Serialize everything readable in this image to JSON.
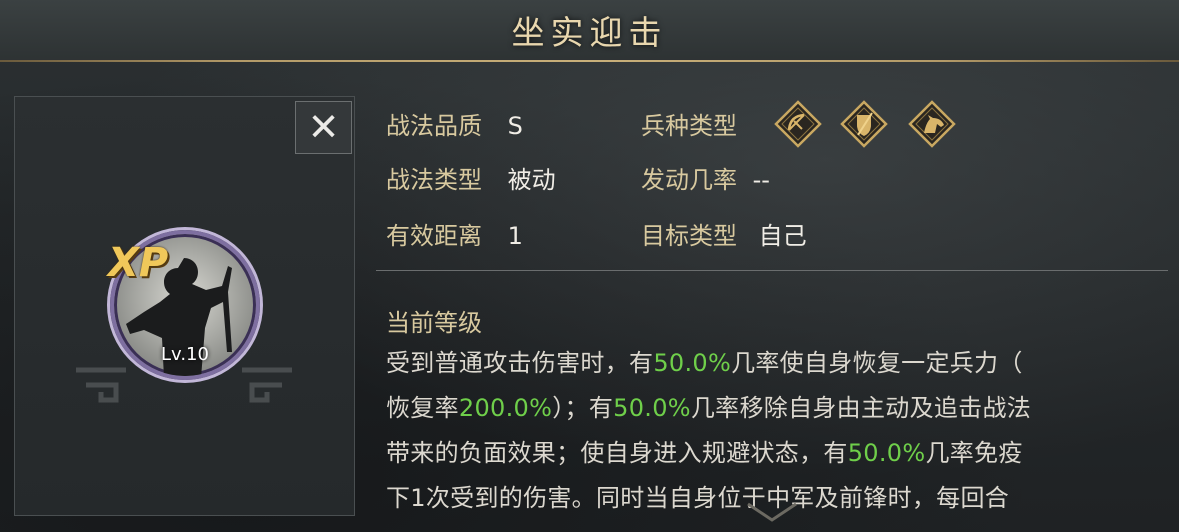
{
  "header": {
    "title": "坐实迎击"
  },
  "close": {
    "label": "✕"
  },
  "skill": {
    "badge": "XP",
    "level": "Lv.10"
  },
  "info": {
    "quality_label": "战法品质",
    "quality_value": "S",
    "type_label": "战法类型",
    "type_value": "被动",
    "range_label": "有效距离",
    "range_value": "1",
    "troop_label": "兵种类型",
    "troop_icons": [
      "bow-icon",
      "shield-icon",
      "horse-icon"
    ],
    "rate_label": "发动几率",
    "rate_value": "--",
    "target_label": "目标类型",
    "target_value": "自己"
  },
  "current_level": {
    "title": "当前等级",
    "lines": [
      [
        {
          "t": "受到普通攻击伤害时，有"
        },
        {
          "t": "50.0%",
          "hl": true
        },
        {
          "t": "几率使自身恢复一定兵力（"
        }
      ],
      [
        {
          "t": "恢复率"
        },
        {
          "t": "200.0%",
          "hl": true
        },
        {
          "t": "）；有"
        },
        {
          "t": "50.0%",
          "hl": true
        },
        {
          "t": "几率移除自身由主动及追击战法"
        }
      ],
      [
        {
          "t": "带来的负面效果；使自身进入规避状态，有"
        },
        {
          "t": "50.0%",
          "hl": true
        },
        {
          "t": "几率免疫"
        }
      ],
      [
        {
          "t": "下1次受到的伤害。同时当自身位于中军及前锋时，每回合"
        }
      ]
    ]
  },
  "colors": {
    "highlight": "#6fcf4a",
    "label_gold": "#d8c99f",
    "title_gold": "#e9d7ae",
    "xp_gold": "#f0c85a",
    "ring_purple": "#7e6fa0"
  }
}
